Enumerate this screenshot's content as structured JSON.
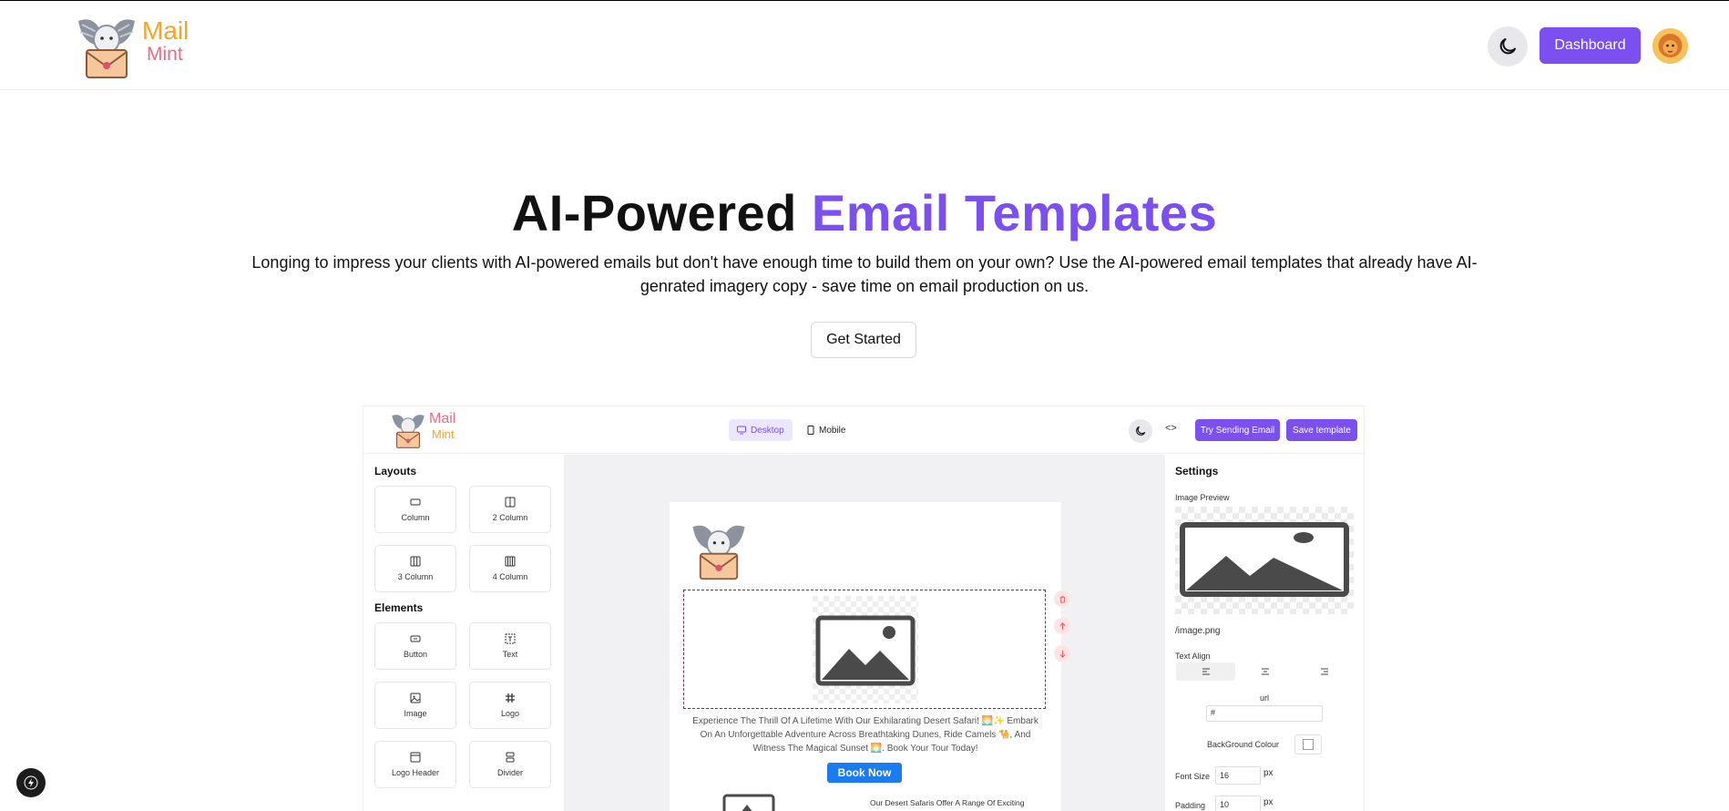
{
  "brand": {
    "line1": "Mail",
    "line2": "Mint"
  },
  "header": {
    "dashboard_label": "Dashboard"
  },
  "hero": {
    "title_plain": "AI-Powered",
    "title_accent": "Email Templates",
    "description": "Longing to impress your clients with AI-powered emails but don't have enough time to build them on your own? Use the AI-powered email templates that already have AI-genrated imagery copy - save time on email production on us.",
    "cta_label": "Get Started"
  },
  "preview": {
    "brand": {
      "line1": "Mail",
      "line2": "Mint"
    },
    "tabs": {
      "desktop": "Desktop",
      "mobile": "Mobile"
    },
    "code_glyph": "<>",
    "try_label": "Try Sending Email",
    "save_label": "Save template",
    "layouts_heading": "Layouts",
    "layouts": [
      "Column",
      "2 Column",
      "3 Column",
      "4 Column"
    ],
    "elements_heading": "Elements",
    "elements": [
      "Button",
      "Text",
      "Image",
      "Logo",
      "Logo Header",
      "Divider"
    ],
    "email": {
      "body_text": "Experience The Thrill Of A Lifetime With Our Exhilarating Desert Safari! 🌅✨ Embark On An Unforgettable Adventure Across Breathtaking Dunes, Ride Camels 🐪, And Witness The Magical Sunset 🌅. Book Your Tour Today!",
      "button_label": "Book Now",
      "sub_text": "Our Desert Safaris Offer A Range Of Exciting"
    },
    "settings": {
      "heading": "Settings",
      "image_preview_label": "Image Preview",
      "image_path": "/image.png",
      "text_align_label": "Text Align",
      "url_label": "url",
      "url_value": "#",
      "bg_colour_label": "BackGround Colour",
      "font_size_label": "Font Size",
      "font_size_value": "16",
      "font_size_unit": "px",
      "padding_label": "Padding",
      "padding_value": "10",
      "padding_unit": "px"
    }
  },
  "colors": {
    "accent": "#7c4ff0",
    "book_button": "#1a7cf0",
    "brand_orange": "#f0a62b",
    "brand_pink": "#ec6a83"
  }
}
